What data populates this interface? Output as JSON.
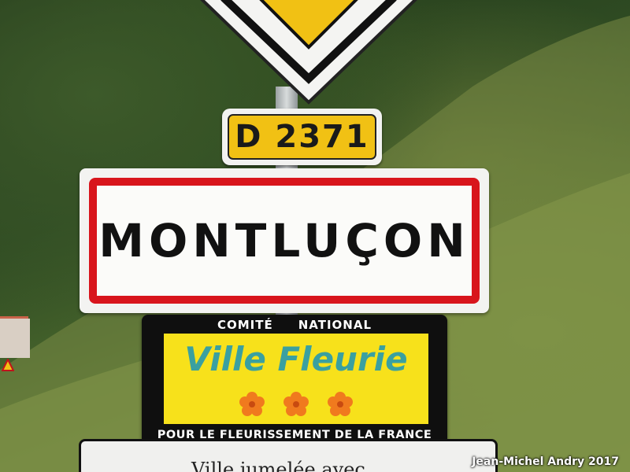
{
  "road_sign": {
    "label": "D 2371",
    "color": "#f1c114"
  },
  "town_sign": {
    "name": "MONTLUÇON",
    "border_color": "#d8151c"
  },
  "fleurie_sign": {
    "top_left": "COMITÉ",
    "top_right": "NATIONAL",
    "title": "Ville Fleurie",
    "bottom": "POUR LE FLEURISSEMENT DE LA FRANCE",
    "flower_count": 3,
    "flower_color": "#f07a1e"
  },
  "bottom_sign": {
    "partial_text": "Ville jumelée avec"
  },
  "credit": "Jean-Michel Andry 2017"
}
